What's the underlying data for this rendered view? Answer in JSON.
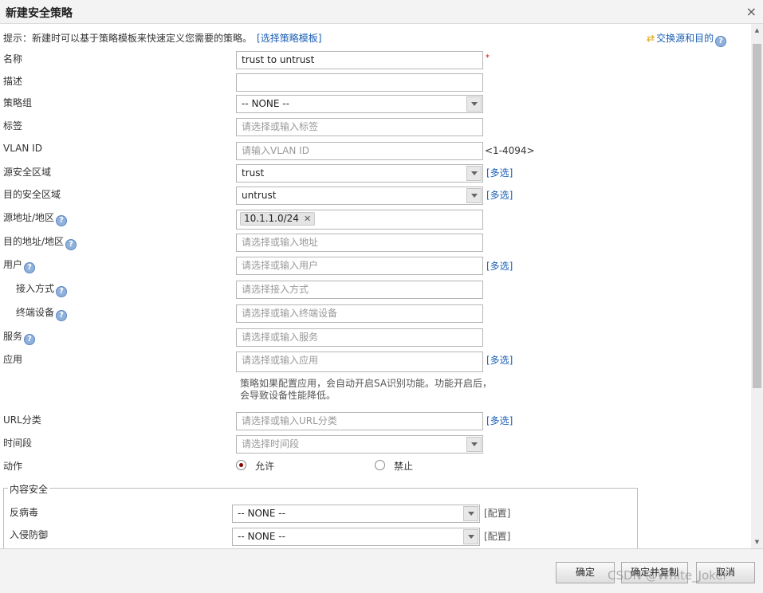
{
  "dialog": {
    "title": "新建安全策略",
    "close_icon": "×"
  },
  "hint": {
    "text": "提示：新建时可以基于策略模板来快速定义您需要的策略。",
    "link": "[选择策略模板]"
  },
  "swap": {
    "label": "交换源和目的",
    "icon": "swap-arrows-icon"
  },
  "form": {
    "name": {
      "label": "名称",
      "value": "trust to untrust",
      "required": "*"
    },
    "desc": {
      "label": "描述",
      "value": ""
    },
    "policy_group": {
      "label": "策略组",
      "value": "-- NONE --"
    },
    "tag": {
      "label": "标签",
      "placeholder": "请选择或输入标签"
    },
    "vlan": {
      "label": "VLAN ID",
      "placeholder": "请输入VLAN ID",
      "range": "<1-4094>"
    },
    "src_zone": {
      "label": "源安全区域",
      "value": "trust",
      "multi": "[多选]"
    },
    "dst_zone": {
      "label": "目的安全区域",
      "value": "untrust",
      "multi": "[多选]"
    },
    "src_addr": {
      "label": "源地址/地区",
      "tag": "10.1.1.0/24"
    },
    "dst_addr": {
      "label": "目的地址/地区",
      "placeholder": "请选择或输入地址"
    },
    "user": {
      "label": "用户",
      "placeholder": "请选择或输入用户",
      "multi": "[多选]"
    },
    "access_mode": {
      "label": "接入方式",
      "placeholder": "请选择接入方式"
    },
    "terminal": {
      "label": "终端设备",
      "placeholder": "请选择或输入终端设备"
    },
    "service": {
      "label": "服务",
      "placeholder": "请选择或输入服务"
    },
    "app": {
      "label": "应用",
      "placeholder": "请选择或输入应用",
      "multi": "[多选]",
      "note": "策略如果配置应用，会自动开启SA识别功能。功能开启后，会导致设备性能降低。"
    },
    "url": {
      "label": "URL分类",
      "placeholder": "请选择或输入URL分类",
      "multi": "[多选]"
    },
    "time": {
      "label": "时间段",
      "placeholder": "请选择时间段"
    },
    "action": {
      "label": "动作",
      "permit": "允许",
      "deny": "禁止"
    }
  },
  "content_security": {
    "legend": "内容安全",
    "antivirus": {
      "label": "反病毒",
      "value": "-- NONE --",
      "config": "[配置]"
    },
    "ips": {
      "label": "入侵防御",
      "value": "-- NONE --",
      "config": "[配置]"
    }
  },
  "help_mark": "?",
  "footer": {
    "ok": "确定",
    "ok_copy": "确定并复制",
    "cancel": "取消",
    "watermark": "CSDN @White_Joker"
  },
  "colors": {
    "link": "#1a5fb4",
    "required": "#dd0000",
    "radio_selected": "#8b0000"
  }
}
